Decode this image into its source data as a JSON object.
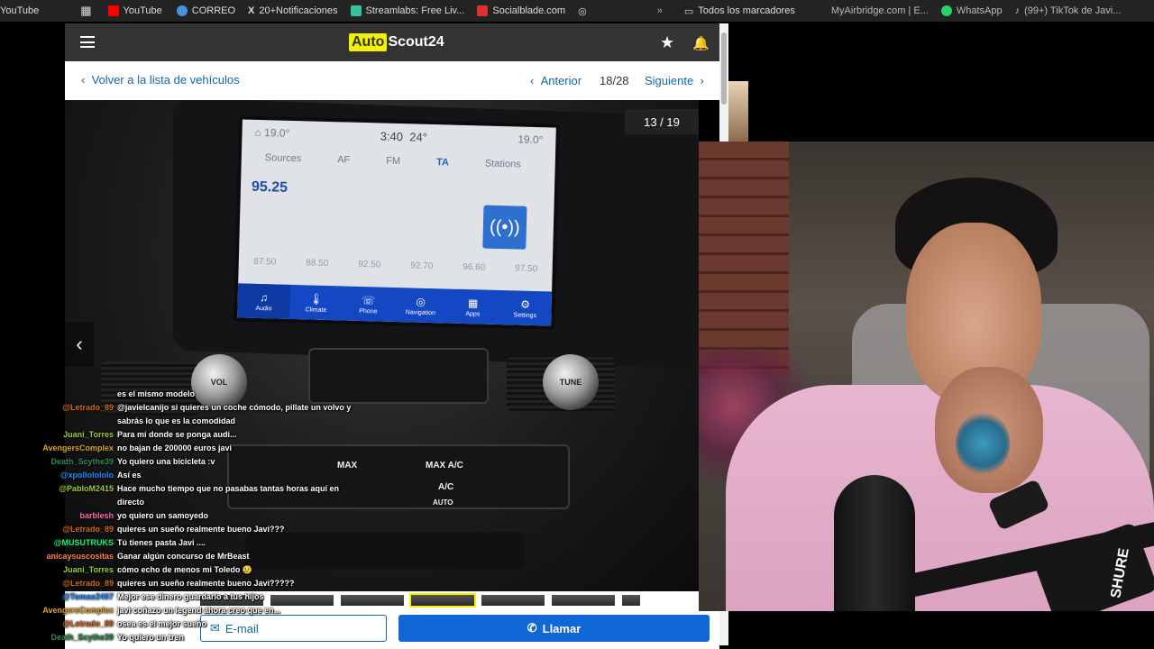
{
  "bookmarks": {
    "items": [
      {
        "label": "YouTube",
        "color": "#ff0000"
      },
      {
        "label": "CORREO",
        "color": "#4a90e2"
      },
      {
        "label": "20+Notificaciones",
        "color": "#ffffff"
      },
      {
        "label": "Streamlabs: Free Liv...",
        "color": "#31c3a2"
      },
      {
        "label": "Socialblade.com",
        "color": "#e03030"
      }
    ],
    "overflow": "»",
    "all_bookmarks": "Todos los marcadores",
    "right_items": [
      "MyAirbridge.com | E...",
      "WhatsApp",
      "(99+) TikTok de Javi..."
    ],
    "left_cut": "YouTube"
  },
  "header": {
    "logo_auto": "Auto",
    "logo_scout": "Scout24",
    "star_icon": "★",
    "bell_icon": "🔔"
  },
  "nav": {
    "back_label": "Volver a la lista de vehículos",
    "prev_label": "Anterior",
    "counter": "18/28",
    "next_label": "Siguiente"
  },
  "gallery": {
    "image_counter": "13 / 19",
    "screen": {
      "temp_left": "19.0°",
      "clock": "3:40",
      "outside_temp": "24°",
      "temp_right": "19.0°",
      "sources": "Sources",
      "af": "AF",
      "fm": "FM",
      "ta": "TA",
      "stations": "Stations",
      "frequency": "95.25",
      "presets": [
        "87.50",
        "88.50",
        "92.50",
        "92.70",
        "96.60",
        "97.50"
      ],
      "tabs": [
        {
          "label": "Audio",
          "icon": "♫"
        },
        {
          "label": "Climate",
          "icon": "🌡"
        },
        {
          "label": "Phone",
          "icon": "☏"
        },
        {
          "label": "Navigation",
          "icon": "◎"
        },
        {
          "label": "Apps",
          "icon": "▦"
        },
        {
          "label": "Settings",
          "icon": "⚙"
        }
      ]
    },
    "knob_vol": "VOL",
    "knob_tune": "TUNE",
    "climate": {
      "max_front": "MAX",
      "max_ac": "MAX A/C",
      "ac": "A/C",
      "auto": "AUTO"
    }
  },
  "footer": {
    "email_label": "E-mail",
    "call_label": "Llamar"
  },
  "chat": [
    {
      "user": "",
      "color": "#ffffff",
      "msg": "es el mismo modelo"
    },
    {
      "user": "@Letrado_89",
      "color": "#d2691e",
      "msg": "@javielcanijo si quieres un coche cómodo, pillate un volvo y sabrás lo que es la comodidad"
    },
    {
      "user": "Juani_Torres",
      "color": "#9acd32",
      "msg": "Para mí donde se ponga audi..."
    },
    {
      "user": "AvengersComplex",
      "color": "#daa520",
      "msg": "no bajan de 200000 euros javi"
    },
    {
      "user": "Death_Scythe39",
      "color": "#2e8b57",
      "msg": "Yo quiero una bicicleta :v"
    },
    {
      "user": "@xpollolololo",
      "color": "#1e90ff",
      "msg": "Así es"
    },
    {
      "user": "@PabloM2415",
      "color": "#9acd32",
      "msg": "Hace mucho tiempo que no pasabas tantas horas aquí en directo"
    },
    {
      "user": "barblesh",
      "color": "#ff69b4",
      "msg": "yo quiero un samoyedo"
    },
    {
      "user": "@Letrado_89",
      "color": "#d2691e",
      "msg": "quieres un sueño realmente bueno Javi???"
    },
    {
      "user": "@MUSUTRUKS",
      "color": "#00ff7f",
      "msg": "Tú tienes pasta Javi ...."
    },
    {
      "user": "anicaysuscositas",
      "color": "#ff7f50",
      "msg": "Ganar algún concurso de MrBeast"
    },
    {
      "user": "Juani_Torres",
      "color": "#9acd32",
      "msg": "cómo echo de menos mi Toledo 😢"
    },
    {
      "user": "@Letrado_89",
      "color": "#d2691e",
      "msg": "quieres un sueño realmente bueno Javi?????"
    },
    {
      "user": "@Tomas2407",
      "color": "#1e90ff",
      "msg": "Mejor ese dinero guardarlo a tus hijos"
    },
    {
      "user": "AvengersComplex",
      "color": "#daa520",
      "msg": "javi coñazo un legend ahora creo que en..."
    },
    {
      "user": "@Letrado_89",
      "color": "#d2691e",
      "msg": "osea es el mejor sueño"
    },
    {
      "user": "Death_Scythe39",
      "color": "#2e8b57",
      "msg": "Yo quiero un tren"
    }
  ],
  "webcam": {
    "mic_brand": "SHURE"
  }
}
